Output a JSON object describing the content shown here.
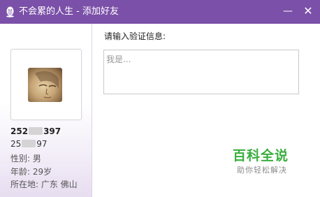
{
  "window": {
    "title": "不会累的人生 - 添加好友",
    "minimize_label": "—",
    "close_label": "✕",
    "icon": "qq-penguin-icon"
  },
  "profile": {
    "id_prefix": "252",
    "id_suffix": "397",
    "nickname_prefix": "25",
    "nickname_suffix": "97",
    "gender": "性别: 男",
    "age": "年龄: 29岁",
    "location": "所在地: 广东  佛山"
  },
  "form": {
    "prompt": "请输入验证信息:",
    "placeholder": "我是..."
  },
  "watermark": {
    "title": "百科全说",
    "subtitle": "助你轻松解决"
  },
  "colors": {
    "titlebar": "#7b50a8",
    "watermark": "#3aae3f"
  }
}
